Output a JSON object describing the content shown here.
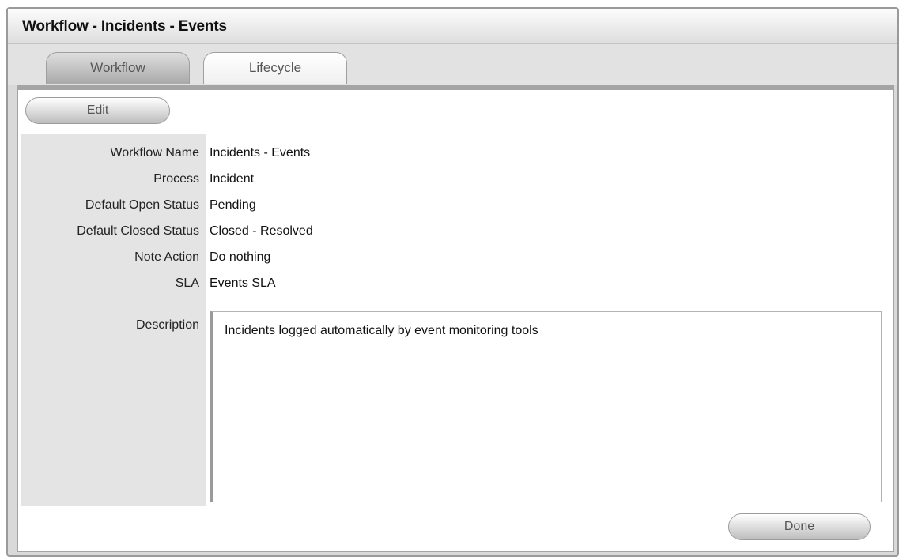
{
  "window": {
    "title": "Workflow - Incidents - Events"
  },
  "tabs": [
    {
      "label": "Workflow",
      "active": true
    },
    {
      "label": "Lifecycle",
      "active": false
    }
  ],
  "toolbar": {
    "edit_label": "Edit"
  },
  "fields": [
    {
      "label": "Workflow Name",
      "value": "Incidents - Events"
    },
    {
      "label": "Process",
      "value": "Incident"
    },
    {
      "label": "Default Open Status",
      "value": "Pending"
    },
    {
      "label": "Default Closed Status",
      "value": "Closed - Resolved"
    },
    {
      "label": "Note Action",
      "value": "Do nothing"
    },
    {
      "label": "SLA",
      "value": "Events SLA"
    }
  ],
  "description": {
    "label": "Description",
    "value": "Incidents logged automatically by event monitoring tools"
  },
  "footer": {
    "done_label": "Done"
  },
  "colors": {
    "tab_rule": "#a4a4a4",
    "label_column": "#e4e4e4"
  }
}
